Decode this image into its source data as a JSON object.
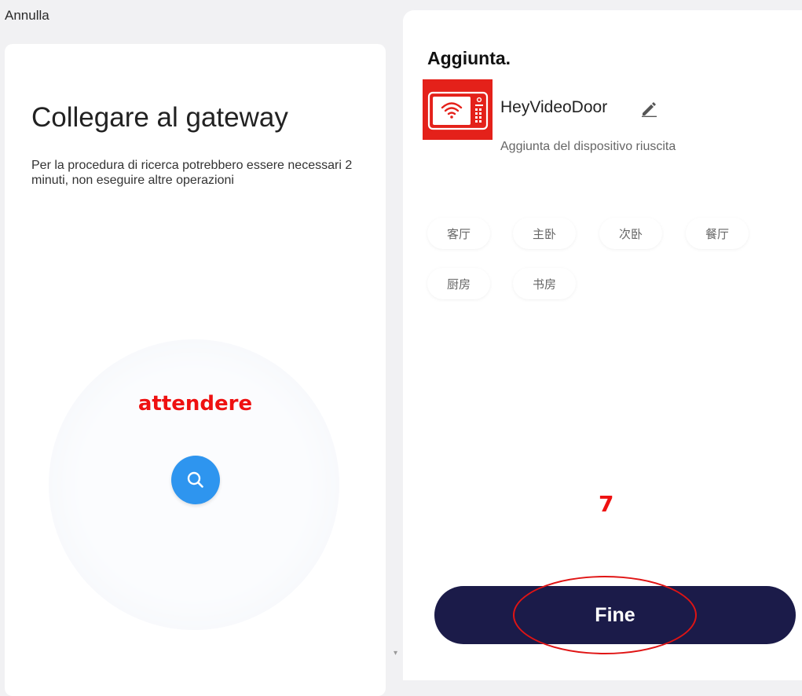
{
  "left_panel": {
    "cancel_label": "Annulla",
    "title": "Collegare al gateway",
    "description": "Per la procedura di ricerca potrebbero essere necessari 2 minuti, non eseguire altre operazioni",
    "wait_annotation": "attendere",
    "search_icon": "search-icon"
  },
  "right_panel": {
    "title": "Aggiunta.",
    "device": {
      "name": "HeyVideoDoor",
      "status": "Aggiunta del dispositivo riuscita",
      "icon": "video-intercom-icon",
      "edit_icon": "pencil-icon"
    },
    "rooms": [
      "客厅",
      "主卧",
      "次卧",
      "餐厅",
      "厨房",
      "书房"
    ],
    "step_annotation": "7",
    "done_label": "Fine"
  },
  "colors": {
    "accent_blue": "#2e95ef",
    "button_navy": "#1b1b49",
    "annotation_red": "#ee1111",
    "device_tile_red": "#e4211a"
  }
}
